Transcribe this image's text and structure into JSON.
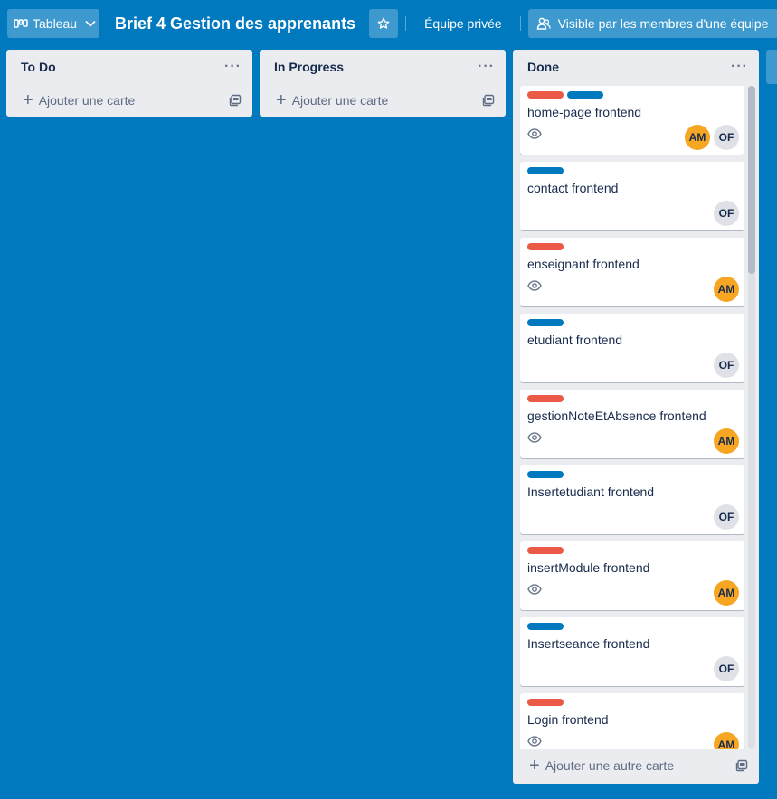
{
  "topbar": {
    "view_label": "Tableau",
    "board_title": "Brief 4 Gestion des apprenants",
    "team_label": "Équipe privée",
    "visibility_label": "Visible par les membres d'une équipe"
  },
  "colors": {
    "background": "#0079bf",
    "label_red": "#eb5a46",
    "label_blue": "#0079bf",
    "avatar_am": "#f6a623",
    "avatar_of": "#dfe1e6"
  },
  "lists": [
    {
      "title": "To Do",
      "menu": "···",
      "add_label": "Ajouter une carte"
    },
    {
      "title": "In Progress",
      "menu": "···",
      "add_label": "Ajouter une carte"
    },
    {
      "title": "Done",
      "menu": "···",
      "add_label": "Ajouter une autre carte"
    }
  ],
  "cards": [
    {
      "title": "home-page frontend",
      "labels": [
        "red",
        "blue"
      ],
      "watching": true,
      "members": [
        "AM",
        "OF"
      ]
    },
    {
      "title": "contact frontend",
      "labels": [
        "blue"
      ],
      "watching": false,
      "members": [
        "OF"
      ]
    },
    {
      "title": "enseignant frontend",
      "labels": [
        "red"
      ],
      "watching": true,
      "members": [
        "AM"
      ]
    },
    {
      "title": "etudiant frontend",
      "labels": [
        "blue"
      ],
      "watching": false,
      "members": [
        "OF"
      ]
    },
    {
      "title": "gestionNoteEtAbsence frontend",
      "labels": [
        "red"
      ],
      "watching": true,
      "members": [
        "AM"
      ]
    },
    {
      "title": "Insertetudiant frontend",
      "labels": [
        "blue"
      ],
      "watching": false,
      "members": [
        "OF"
      ]
    },
    {
      "title": "insertModule frontend",
      "labels": [
        "red"
      ],
      "watching": true,
      "members": [
        "AM"
      ]
    },
    {
      "title": "Insertseance frontend",
      "labels": [
        "blue"
      ],
      "watching": false,
      "members": [
        "OF"
      ]
    },
    {
      "title": "Login frontend",
      "labels": [
        "red"
      ],
      "watching": true,
      "members": [
        "AM"
      ]
    }
  ]
}
